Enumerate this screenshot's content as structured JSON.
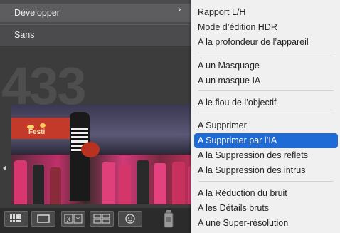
{
  "left_menu": {
    "items": [
      {
        "label": "Développer",
        "has_submenu": true,
        "highlighted": true
      },
      {
        "label": "Sans",
        "has_submenu": false,
        "highlighted": false
      }
    ]
  },
  "background": {
    "image_count_partial": "433",
    "photo_banner_text": "Festi"
  },
  "submenu": {
    "groups": [
      {
        "items": [
          {
            "label": "Rapport L/H"
          },
          {
            "label": "Mode d’édition HDR"
          },
          {
            "label": "A la profondeur de l’appareil"
          }
        ]
      },
      {
        "items": [
          {
            "label": "A un Masquage"
          },
          {
            "label": "A un masque IA"
          }
        ]
      },
      {
        "items": [
          {
            "label": "A le flou de l’objectif"
          }
        ]
      },
      {
        "items": [
          {
            "label": "A Supprimer"
          },
          {
            "label": "A Supprimer par l’IA",
            "selected": true
          },
          {
            "label": "A la Suppression des reflets"
          },
          {
            "label": "A la Suppression des intrus"
          }
        ]
      },
      {
        "items": [
          {
            "label": "A la Réduction du bruit"
          },
          {
            "label": "A les Détails bruts"
          },
          {
            "label": "A une Super-résolution"
          }
        ]
      }
    ]
  },
  "toolbar": {
    "buttons": [
      {
        "icon": "grid-view-icon"
      },
      {
        "icon": "loupe-view-icon"
      },
      {
        "icon": "compare-view-icon",
        "label": "X|Y"
      },
      {
        "icon": "survey-view-icon"
      },
      {
        "icon": "people-view-icon"
      },
      {
        "icon": "spray-can-icon"
      }
    ]
  },
  "colors": {
    "selection": "#1f6bd6",
    "menu_bg": "#f0f0f0",
    "parent_menu_bg": "#4b4b4d"
  }
}
